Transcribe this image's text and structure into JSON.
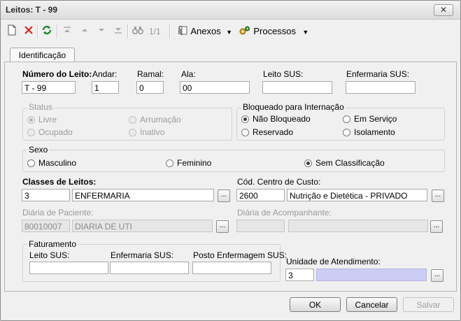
{
  "window": {
    "title": "Leitos: T - 99",
    "close_label": "✕"
  },
  "toolbar": {
    "record_position": "1/1",
    "attachments_label": "Anexos",
    "processes_label": "Processos"
  },
  "tabs": [
    {
      "label": "Identificação"
    }
  ],
  "form": {
    "numero_leito": {
      "label": "Número do Leito:",
      "value": "T - 99"
    },
    "andar": {
      "label": "Andar:",
      "value": "1"
    },
    "ramal": {
      "label": "Ramal:",
      "value": "0"
    },
    "ala": {
      "label": "Ala:",
      "value": "00"
    },
    "leito_sus": {
      "label": "Leito SUS:",
      "value": ""
    },
    "enfermaria_sus": {
      "label": "Enfermaria SUS:",
      "value": ""
    },
    "status": {
      "label": "Status",
      "options": [
        "Livre",
        "Arrumação",
        "Ocupado",
        "Inativo"
      ],
      "selected": "Livre"
    },
    "bloqueado": {
      "label": "Bloqueado para Internação",
      "options": [
        "Não Bloqueado",
        "Em Serviço",
        "Reservado",
        "Isolamento"
      ],
      "selected": "Não Bloqueado"
    },
    "sexo": {
      "label": "Sexo",
      "options": [
        "Masculino",
        "Feminino",
        "Sem Classificação"
      ],
      "selected": "Sem Classificação"
    },
    "classes_leitos": {
      "label": "Classes de Leitos:",
      "code": "3",
      "name": "ENFERMARIA"
    },
    "centro_custo": {
      "label": "Cód. Centro de Custo:",
      "code": "2600",
      "name": "Nutrição e Dietética  - PRIVADO"
    },
    "diaria_paciente": {
      "label": "Diária de Paciente:",
      "code": "80010007",
      "name": "DIARIA DE UTI"
    },
    "diaria_acompanhante": {
      "label": "Diária de Acompanhante:",
      "code": "",
      "name": ""
    },
    "faturamento": {
      "label": "Faturamento",
      "leito_sus_label": "Leito SUS:",
      "enfermaria_sus_label": "Enfermaria SUS:",
      "posto_enfermagem_label": "Posto Enfermagem SUS:",
      "leito_sus": "",
      "enfermaria_sus": "",
      "posto_enfermagem": ""
    },
    "unidade_atendimento": {
      "label": "Unidade de Atendimento:",
      "code": "3",
      "name": ""
    },
    "ellipsis_label": "..."
  },
  "buttons": {
    "ok": "OK",
    "cancel": "Cancelar",
    "save": "Salvar"
  },
  "colors": {
    "lookup_highlight": "#ccccf4",
    "panel_bg": "#f0f0f0"
  }
}
